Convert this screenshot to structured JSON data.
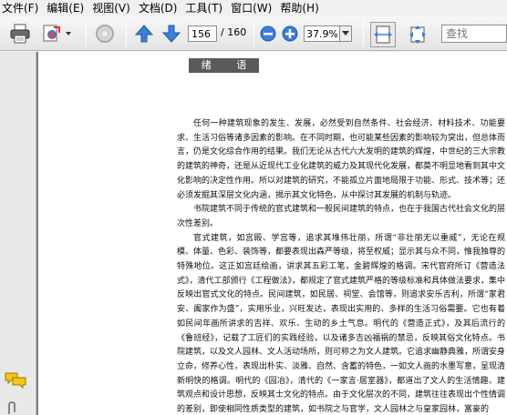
{
  "menu": {
    "items": [
      "文件(F)",
      "编辑(E)",
      "视图(V)",
      "文档(D)",
      "工具(T)",
      "窗口(W)",
      "帮助(H)"
    ]
  },
  "toolbar": {
    "current_page": "156",
    "total_pages": "/ 160",
    "zoom": "37.9%",
    "search_placeholder": "查找"
  },
  "icons": {
    "print": "printer-icon",
    "export": "export-icon",
    "disabled": "disabled-circle-icon",
    "prev": "arrow-up-icon",
    "next": "arrow-down-icon",
    "zoom_out": "zoom-out-icon",
    "zoom_in": "zoom-in-icon",
    "fit_width": "fit-width-icon",
    "fit_page": "fit-page-icon",
    "comments": "comments-icon",
    "attachment": "paperclip-icon"
  },
  "document": {
    "chapter_heading": "绪 语",
    "paragraphs": [
      "任何一种建筑现象的发生、发展，必然受到自然条件、社会经济、材料技术、功能要求、生活习俗等诸多因素的影响。在不同时期，也可能某些因素的影响较为突出，但总体而言，仍是文化综合作用的结果。我们无论从古代六大发明的建筑的辉煌，中世纪的三大宗教的建筑的神奇，还是从近现代工业化建筑的威力及其现代化发展，都莫不明显地看到其中文化影响的决定性作用。所以对建筑的研究，不能孤立片面地局限于功能、形式、技术等；还必须发掘其深层文化内涵，揭示其文化特色，从中探讨其发展的机制与轨迹。",
      "书院建筑不同于传统的官式建筑和一般民间建筑的特点，也在于我国古代社会文化的层次性差别。",
      "官式建筑，如宫殿、学宫等，追求其堆伟壮丽，所谓“非壮丽无以重威”，无论在规模、体量、色彩、装饰等，都要表现出森严等级，将至权威；显示其与众不同，惟我独尊的特殊地位。这正如宫廷绘画，讲求其五彩工笔，金碧辉煌的格调。宋代官府所订《营造法式》，清代工部颁行《工程做法》，都规定了官式建筑严格的等级标准和具体做法要求，集中反映出官式文化的特点。民间建筑，如民居、祠堂、会馆等，则追求安乐吉利，所谓“家君安、阖家作为盛”，实用乐业，兴旺发达，表现出实用的、多样的生活习俗需要。它也有着如民间年画所讲求的吉祥、欢乐、生动的乡土气息。明代的《营造正式》，及其后流行的《鲁班经》，记载了工匠们的实践经验，以及诸多吉凶福祸的禁忌，反映其俗文化特点。书院建筑，以及文人园林、文人活动场所，则可称之为文人建筑。它追求幽静典雅，所谓安身立命，修养心性，表现出朴实、淡雅、自然、含蓄的特色，一如文人画的水墨写意，呈现清新明快的格调。明代的《园冶》，清代的《一家言·居室器》，都道出了文人的生活情趣、建筑观点和设计思想，反映其士文化的特点。由于文化层次的不同，建筑往往表现出个性情调的差别，即使相同性质类型的建筑，如书院之与官学，文人园林之与皇家园林，富豪的"
    ]
  }
}
